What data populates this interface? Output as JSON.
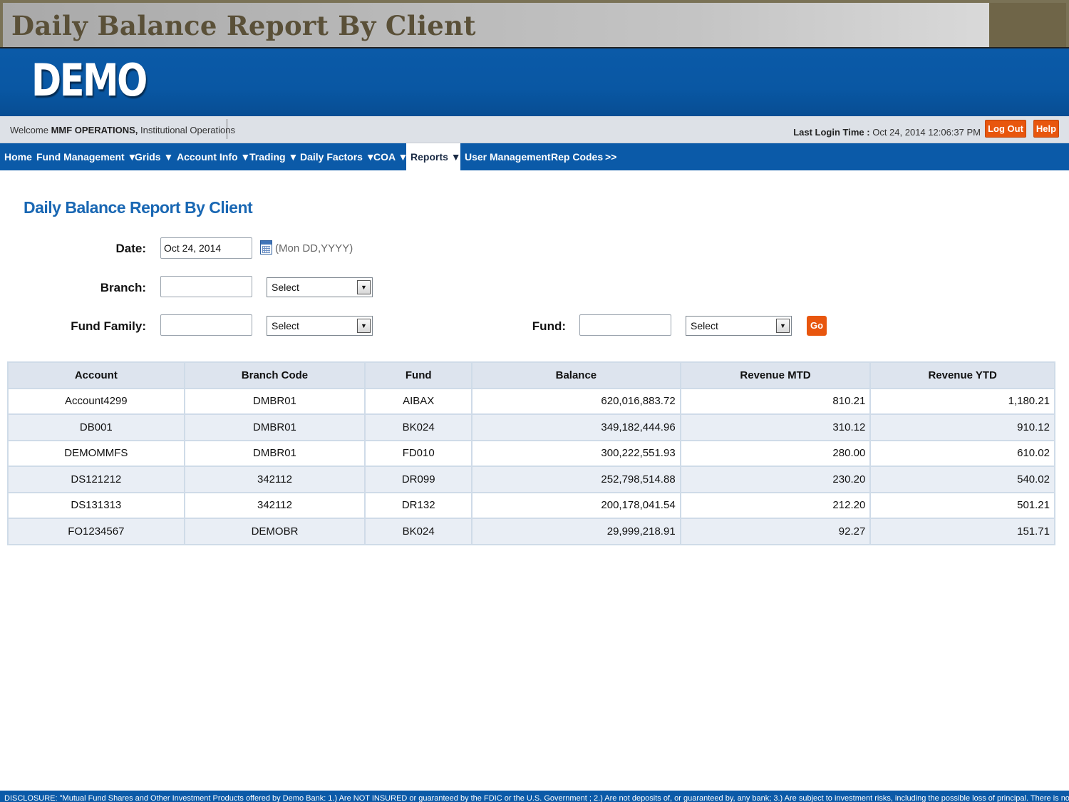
{
  "slide": {
    "title": "Daily Balance Report By Client"
  },
  "header": {
    "logo": "DEMO"
  },
  "welcome": {
    "prefix": "Welcome",
    "user": "MMF OPERATIONS,",
    "org": "Institutional Operations",
    "last_login_label": "Last Login Time :",
    "last_login_value": "Oct 24, 2014 12:06:37 PM",
    "logout_label": "Log Out",
    "help_label": "Help"
  },
  "nav": {
    "items": [
      "Home",
      "Fund Management ▼",
      "Grids ▼",
      "Account Info ▼",
      "Trading ▼",
      "Daily Factors ▼",
      "COA ▼",
      "Reports ▼",
      "User Management",
      "Rep Codes",
      ">>"
    ],
    "active_index": 7
  },
  "page": {
    "heading": "Daily Balance Report By Client"
  },
  "form": {
    "date_label": "Date:",
    "date_value": "Oct 24, 2014",
    "date_hint": "(Mon DD,YYYY)",
    "branch_label": "Branch:",
    "branch_value": "",
    "branch_select": "Select",
    "fund_family_label": "Fund Family:",
    "fund_family_value": "",
    "fund_family_select": "Select",
    "fund_label": "Fund:",
    "fund_value": "",
    "fund_select": "Select",
    "go_label": "Go"
  },
  "table": {
    "columns": [
      "Account",
      "Branch Code",
      "Fund",
      "Balance",
      "Revenue MTD",
      "Revenue YTD"
    ],
    "rows": [
      [
        "Account4299",
        "DMBR01",
        "AIBAX",
        "620,016,883.72",
        "810.21",
        "1,180.21"
      ],
      [
        "DB001",
        "DMBR01",
        "BK024",
        "349,182,444.96",
        "310.12",
        "910.12"
      ],
      [
        "DEMOMMFS",
        "DMBR01",
        "FD010",
        "300,222,551.93",
        "280.00",
        "610.02"
      ],
      [
        "DS121212",
        "342112",
        "DR099",
        "252,798,514.88",
        "230.20",
        "540.02"
      ],
      [
        "DS131313",
        "342112",
        "DR132",
        "200,178,041.54",
        "212.20",
        "501.21"
      ],
      [
        "FO1234567",
        "DEMOBR",
        "BK024",
        "29,999,218.91",
        "92.27",
        "151.71"
      ]
    ]
  },
  "disclosure": {
    "text": "DISCLOSURE: \"Mutual Fund Shares and Other Investment Products offered by Demo Bank: 1.) Are NOT INSURED or guaranteed by the FDIC or the U.S. Government ; 2.) Are not deposits of, or guaranteed by, any bank; 3.) Are subject to investment risks, including the possible loss of principal. There is no assurance"
  },
  "colors": {
    "brand_blue": "#0b5aa8",
    "accent_orange": "#e8560e",
    "heading_blue": "#1967b3"
  }
}
